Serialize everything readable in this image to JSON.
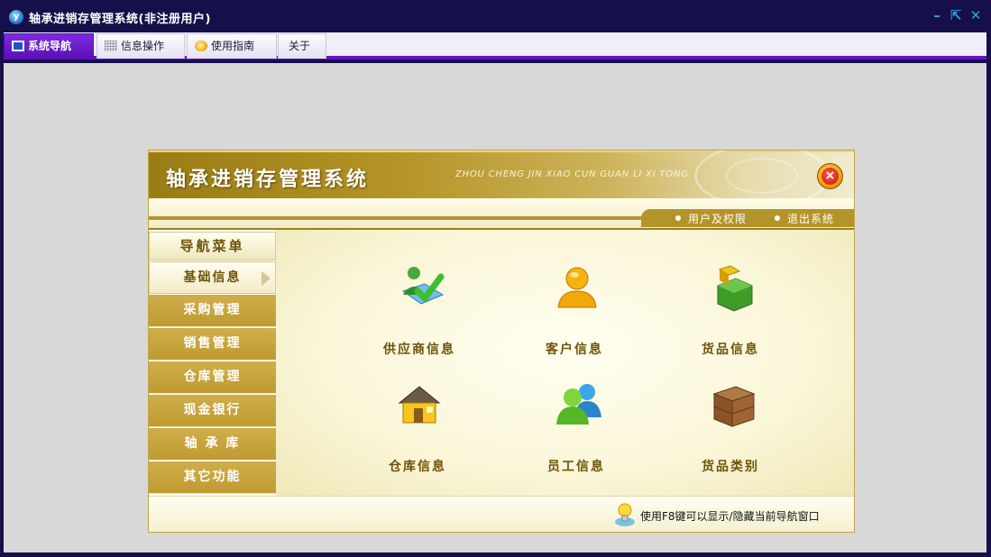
{
  "window": {
    "title": "轴承进销存管理系统(非注册用户)",
    "icon": "app-logo-icon",
    "controls": {
      "minimize": "–",
      "restore": "⇱",
      "close": "✕"
    }
  },
  "tabs": [
    {
      "label": "系统导航",
      "icon": "monitor-icon",
      "active": true
    },
    {
      "label": "信息操作",
      "icon": "grid-icon",
      "active": false
    },
    {
      "label": "使用指南",
      "icon": "guide-icon",
      "active": false
    },
    {
      "label": "关于",
      "active": false
    }
  ],
  "panel": {
    "title": "轴承进销存管理系统",
    "subtitle": "ZHOU CHENG JIN XIAO CUN GUAN LI XI TONG",
    "close_symbol": "×",
    "links": [
      "用户及权限",
      "退出系统"
    ],
    "menu_title": "导航菜单",
    "menu_items": [
      "基础信息",
      "采购管理",
      "销售管理",
      "仓库管理",
      "现金银行",
      "轴 承 库",
      "其它功能"
    ],
    "active_menu_index": 0,
    "modules": [
      {
        "label": "供应商信息",
        "icon": "supplier-icon"
      },
      {
        "label": "客户信息",
        "icon": "customer-icon"
      },
      {
        "label": "货品信息",
        "icon": "product-icon"
      },
      {
        "label": "仓库信息",
        "icon": "warehouse-icon"
      },
      {
        "label": "员工信息",
        "icon": "employees-icon"
      },
      {
        "label": "货品类别",
        "icon": "category-box-icon"
      }
    ],
    "tip": "使用F8键可以显示/隐藏当前导航窗口"
  },
  "colors": {
    "titlebar": "#15104a",
    "tab_accent": "#6a12c4",
    "gold": "#c09a30",
    "workspace": "#d8d8d8"
  }
}
